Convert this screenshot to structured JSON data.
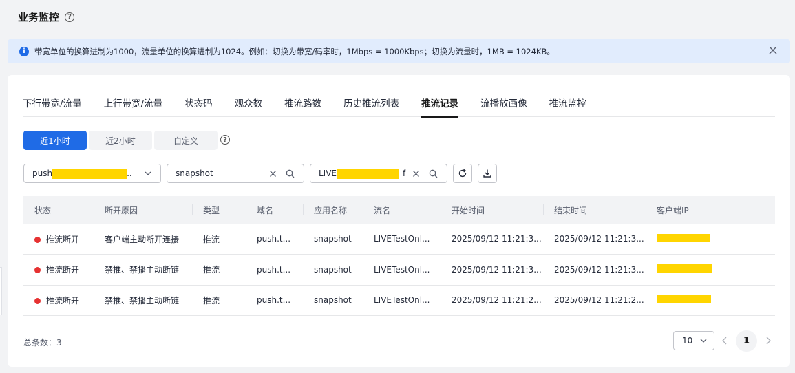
{
  "header": {
    "title": "业务监控",
    "help_glyph": "?"
  },
  "notice": {
    "text": "带宽单位的换算进制为1000，流量单位的换算进制为1024。例如：切换为带宽/码率时，1Mbps = 1000Kbps；切换为流量时，1MB = 1024KB。",
    "info_glyph": "i"
  },
  "tabs": [
    {
      "label": "下行带宽/流量"
    },
    {
      "label": "上行带宽/流量"
    },
    {
      "label": "状态码"
    },
    {
      "label": "观众数"
    },
    {
      "label": "推流路数"
    },
    {
      "label": "历史推流列表"
    },
    {
      "label": "推流记录",
      "active": true
    },
    {
      "label": "流播放画像"
    },
    {
      "label": "推流监控"
    }
  ],
  "time_range": {
    "options": [
      "近1小时",
      "近2小时",
      "自定义"
    ],
    "selected": "近1小时",
    "help_glyph": "?"
  },
  "filters": {
    "domain_prefix": "push",
    "domain_suffix": "..",
    "app_name": "snapshot",
    "stream_prefix": "LIVE",
    "stream_suffix": "_f"
  },
  "table": {
    "columns": [
      "状态",
      "断开原因",
      "类型",
      "域名",
      "应用名称",
      "流名",
      "开始时间",
      "结束时间",
      "客户端IP"
    ],
    "rows": [
      {
        "status": "推流断开",
        "reason": "客户端主动断开连接",
        "type": "推流",
        "domain": "push.t...",
        "app": "snapshot",
        "stream": "LIVETestOnl...",
        "start": "2025/09/12 11:21:3...",
        "end": "2025/09/12 11:21:3..."
      },
      {
        "status": "推流断开",
        "reason": "禁推、禁播主动断链",
        "type": "推流",
        "domain": "push.t...",
        "app": "snapshot",
        "stream": "LIVETestOnl...",
        "start": "2025/09/12 11:21:3...",
        "end": "2025/09/12 11:21:3..."
      },
      {
        "status": "推流断开",
        "reason": "禁推、禁播主动断链",
        "type": "推流",
        "domain": "push.t...",
        "app": "snapshot",
        "stream": "LIVETestOnl...",
        "start": "2025/09/12 11:21:2...",
        "end": "2025/09/12 11:21:2..."
      }
    ]
  },
  "footer": {
    "total_label": "总条数：3",
    "page_size": "10",
    "current_page": "1"
  },
  "colors": {
    "primary": "#1f6be6",
    "status_red": "#e63232",
    "mask_yellow": "#ffd500"
  },
  "icons": [
    "help-icon",
    "info-icon",
    "close-icon",
    "chevron-down-icon",
    "clear-icon",
    "search-icon",
    "refresh-icon",
    "download-icon",
    "chevron-left-icon",
    "chevron-right-icon"
  ]
}
